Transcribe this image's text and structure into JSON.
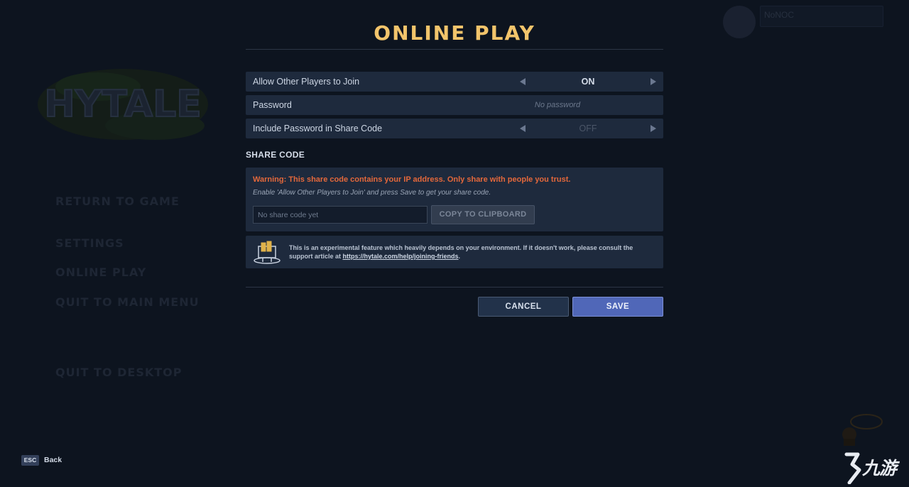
{
  "background": {
    "logo_text": "HYTALE",
    "menu": [
      {
        "id": "return",
        "label": "RETURN TO GAME"
      },
      {
        "id": "settings",
        "label": "SETTINGS"
      },
      {
        "id": "online",
        "label": "ONLINE PLAY"
      },
      {
        "id": "quit-menu",
        "label": "QUIT TO MAIN MENU"
      },
      {
        "id": "quit-desktop",
        "label": "QUIT TO DESKTOP"
      }
    ],
    "username": "NoNOC"
  },
  "dialog": {
    "title": "ONLINE PLAY",
    "allow_join": {
      "label": "Allow Other Players to Join",
      "value": "ON"
    },
    "password": {
      "label": "Password",
      "placeholder": "No password"
    },
    "include_password": {
      "label": "Include Password in Share Code",
      "value": "OFF"
    },
    "share_code": {
      "heading": "SHARE CODE",
      "warning": "Warning: This share code contains your IP address. Only share with people you trust.",
      "hint": "Enable 'Allow Other Players to Join' and press Save to get your share code.",
      "input_placeholder": "No share code yet",
      "copy_label": "COPY TO CLIPBOARD"
    },
    "info": {
      "text": "This is an experimental feature which heavily depends on your environment. If it doesn't work, please consult the support article at ",
      "link": "https://hytale.com/help/joining-friends",
      "suffix": "."
    },
    "cancel_label": "CANCEL",
    "save_label": "SAVE"
  },
  "footer": {
    "esc_key": "ESC",
    "back_label": "Back"
  },
  "watermark": {
    "text": "九游"
  },
  "colors": {
    "accent_title": "#f2c46b",
    "warning": "#e4683b",
    "save_button": "#5067b8",
    "background": "#0d141f"
  }
}
